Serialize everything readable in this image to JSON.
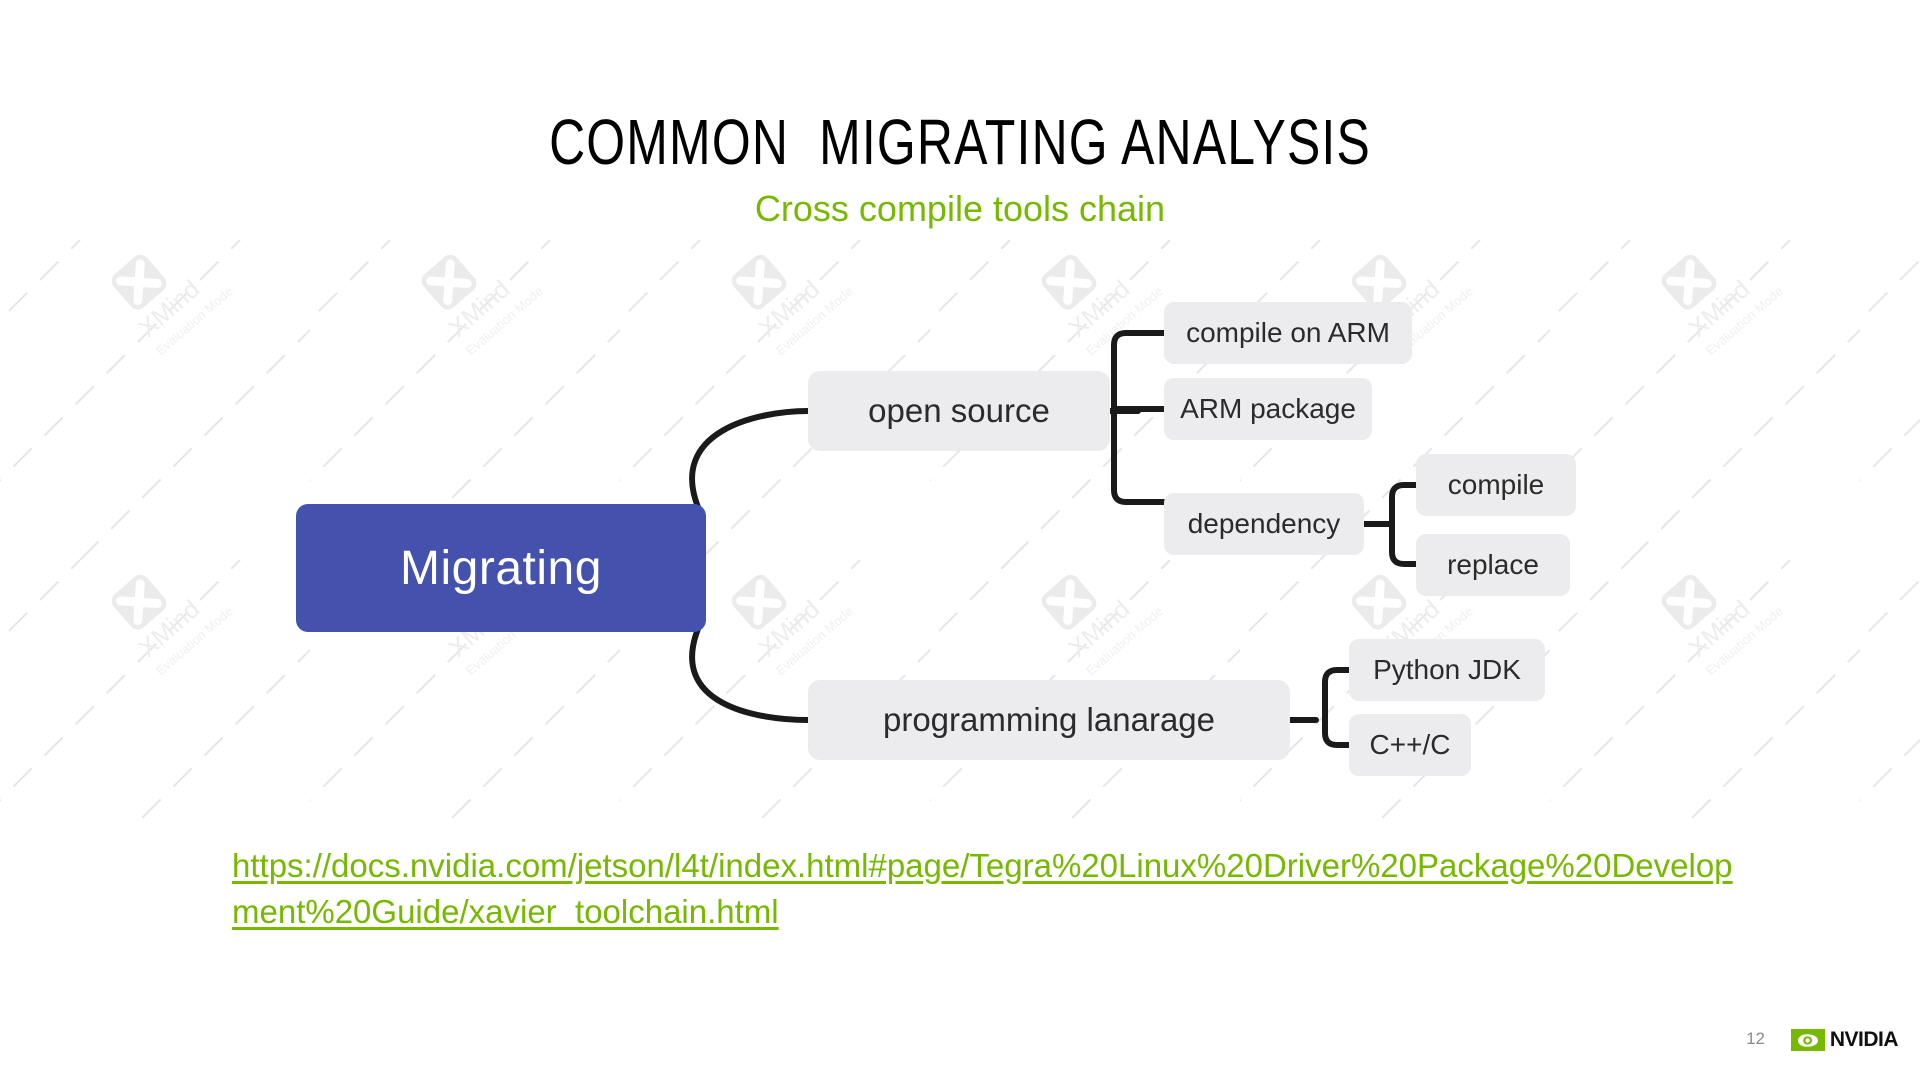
{
  "slide": {
    "title": "COMMON  MIGRATING ANALYSIS",
    "subtitle": "Cross compile tools chain",
    "background_color": "#ffffff",
    "accent_color": "#76b900",
    "root_node_color": "#4452ad",
    "node_color": "#ececee"
  },
  "mindmap": {
    "root": {
      "label": "Migrating"
    },
    "branches": [
      {
        "label": "open source",
        "children": [
          {
            "label": "compile on ARM",
            "children": []
          },
          {
            "label": "ARM package",
            "children": []
          },
          {
            "label": "dependency",
            "children": [
              {
                "label": "compile"
              },
              {
                "label": "replace"
              }
            ]
          }
        ]
      },
      {
        "label": "programming lanarage",
        "children": [
          {
            "label": "Python JDK",
            "children": []
          },
          {
            "label": "C++/C",
            "children": []
          }
        ]
      }
    ],
    "watermark": {
      "product": "XMind",
      "mode": "Evaluation Mode",
      "icon": "xmind-x-icon"
    }
  },
  "link": {
    "text": "https://docs.nvidia.com/jetson/l4t/index.html#page/Tegra%20Linux%20Driver%20Package%20Development%20Guide/xavier_toolchain.html"
  },
  "footer": {
    "page_number": "12",
    "brand": "NVIDIA",
    "brand_icon": "nvidia-eye-icon"
  }
}
